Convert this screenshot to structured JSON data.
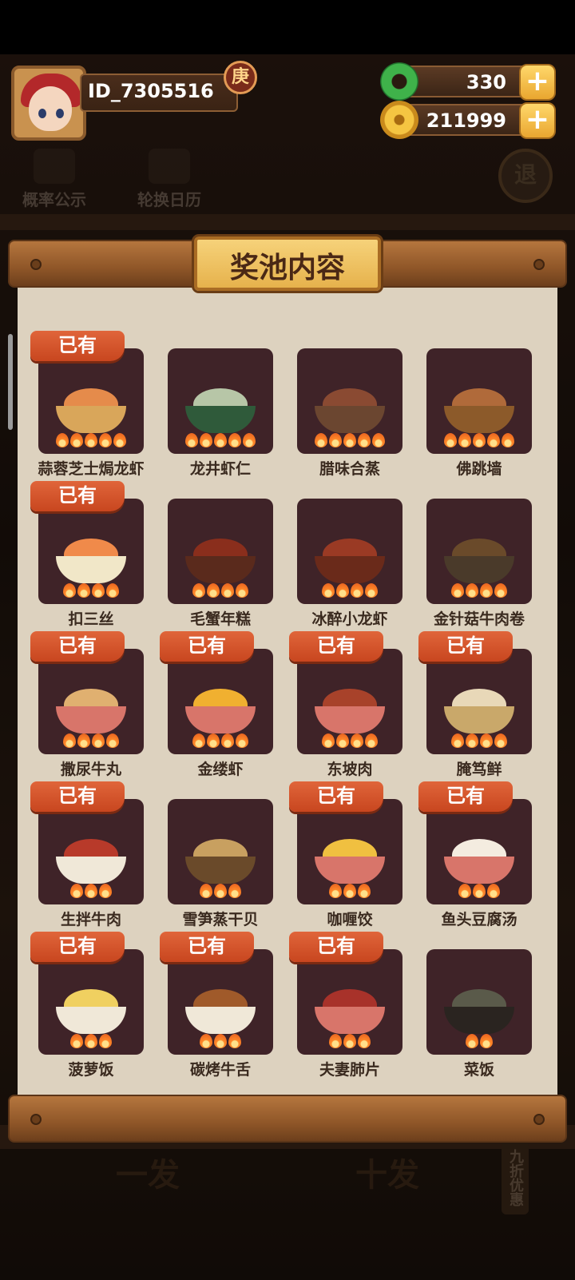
{
  "player": {
    "id": "ID_7305516",
    "rank_badge": "庚"
  },
  "resources": {
    "jade": {
      "value": "330",
      "icon": "jade-icon"
    },
    "coins": {
      "value": "211999",
      "icon": "coin-icon"
    }
  },
  "background": {
    "probability_label": "概率公示",
    "calendar_label": "轮换日历",
    "exit_label": "退",
    "draw_one_label": "一发",
    "draw_ten_label": "十发",
    "discount_label": "九折优惠"
  },
  "panel": {
    "title": "奖池内容",
    "owned_label": "已有",
    "dishes": [
      {
        "name": "蒜蓉芝士焗龙虾",
        "owned": true,
        "stars": 5,
        "color": "#e58b4b",
        "bowl": "#d9a65a"
      },
      {
        "name": "龙井虾仁",
        "owned": false,
        "stars": 5,
        "color": "#b7c6a7",
        "bowl": "#2f5a3a"
      },
      {
        "name": "腊味合蒸",
        "owned": false,
        "stars": 5,
        "color": "#8a4a32",
        "bowl": "#6b4630"
      },
      {
        "name": "佛跳墙",
        "owned": false,
        "stars": 5,
        "color": "#b06a3a",
        "bowl": "#8c5a2a"
      },
      {
        "name": "扣三丝",
        "owned": true,
        "stars": 4,
        "color": "#f08a4a",
        "bowl": "#f1e7c8"
      },
      {
        "name": "毛蟹年糕",
        "owned": false,
        "stars": 4,
        "color": "#8a2e1c",
        "bowl": "#5a2a1c"
      },
      {
        "name": "冰醉小龙虾",
        "owned": false,
        "stars": 4,
        "color": "#9a3a24",
        "bowl": "#6a2a1a"
      },
      {
        "name": "金针菇牛肉卷",
        "owned": false,
        "stars": 4,
        "color": "#6a4a2a",
        "bowl": "#4a3a2a"
      },
      {
        "name": "撒尿牛丸",
        "owned": true,
        "stars": 4,
        "color": "#e0b070",
        "bowl": "#d8756a"
      },
      {
        "name": "金缕虾",
        "owned": true,
        "stars": 4,
        "color": "#f0b030",
        "bowl": "#d8756a"
      },
      {
        "name": "东坡肉",
        "owned": true,
        "stars": 4,
        "color": "#a8422a",
        "bowl": "#d8756a"
      },
      {
        "name": "腌笃鲜",
        "owned": true,
        "stars": 4,
        "color": "#e8d8b8",
        "bowl": "#c9a86a"
      },
      {
        "name": "生拌牛肉",
        "owned": true,
        "stars": 3,
        "color": "#b83a2a",
        "bowl": "#f0e8d8"
      },
      {
        "name": "雪笋蒸干贝",
        "owned": false,
        "stars": 3,
        "color": "#c8a060",
        "bowl": "#6a4a2a"
      },
      {
        "name": "咖喱饺",
        "owned": true,
        "stars": 3,
        "color": "#f0c040",
        "bowl": "#d8756a"
      },
      {
        "name": "鱼头豆腐汤",
        "owned": true,
        "stars": 3,
        "color": "#f4ece0",
        "bowl": "#d8756a"
      },
      {
        "name": "菠萝饭",
        "owned": true,
        "stars": 3,
        "color": "#f0d060",
        "bowl": "#f0e8d8"
      },
      {
        "name": "碳烤牛舌",
        "owned": true,
        "stars": 3,
        "color": "#a05a2a",
        "bowl": "#f0e8d8"
      },
      {
        "name": "夫妻肺片",
        "owned": true,
        "stars": 3,
        "color": "#a8322a",
        "bowl": "#d8756a"
      },
      {
        "name": "菜饭",
        "owned": false,
        "stars": 2,
        "color": "#5a5a4a",
        "bowl": "#2a2420"
      }
    ]
  }
}
